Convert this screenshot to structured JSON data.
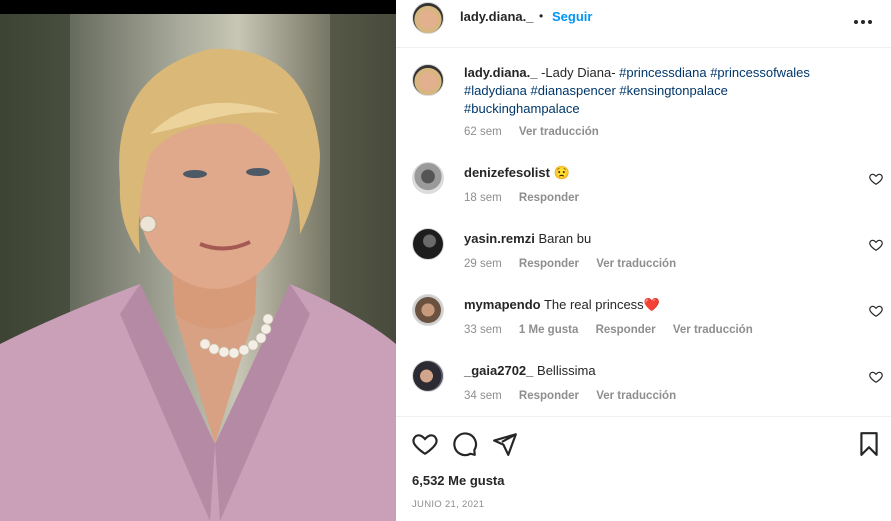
{
  "post": {
    "author": "lady.diana._",
    "dot": "•",
    "follow_label": "Seguir"
  },
  "caption": {
    "username": "lady.diana._",
    "text": "-Lady Diana- ",
    "hashtags_line1": "#princessdiana #princessofwales",
    "hashtags_line2": "#ladydiana #dianaspencer #kensingtonpalace",
    "hashtags_line3": "#buckinghampalace",
    "time": "62 sem",
    "translate": "Ver traducción"
  },
  "comments": [
    {
      "username": "denizefesolist",
      "text": "😟",
      "time": "18 sem",
      "likes": "",
      "reply": "Responder",
      "translate": ""
    },
    {
      "username": "yasin.remzi",
      "text": "Baran bu",
      "time": "29 sem",
      "likes": "",
      "reply": "Responder",
      "translate": "Ver traducción"
    },
    {
      "username": "mymapendo",
      "text": "The real princess❤️",
      "time": "33 sem",
      "likes": "1 Me gusta",
      "reply": "Responder",
      "translate": "Ver traducción"
    },
    {
      "username": "_gaia2702_",
      "text": "Bellissima",
      "time": "34 sem",
      "likes": "",
      "reply": "Responder",
      "translate": "Ver traducción"
    }
  ],
  "footer": {
    "likes": "6,532 Me gusta",
    "date": "JUNIO 21, 2021"
  },
  "icons": {
    "like": "heart-icon",
    "comment": "comment-icon",
    "share": "share-icon",
    "save": "bookmark-icon",
    "more": "more-options-icon"
  }
}
